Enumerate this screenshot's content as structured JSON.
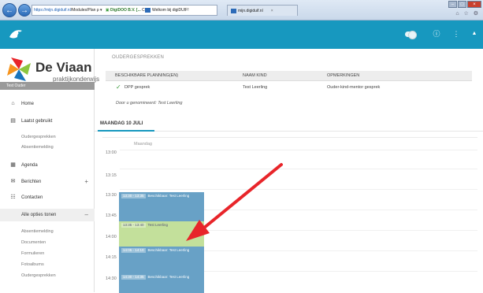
{
  "browser": {
    "url_host": "https://mijn.digiduif.nl",
    "url_path": "/Modules/Plan",
    "url_search": "ρ ▾",
    "cert_name": "DigiDOO B.V. [...",
    "cert_suffix": "C",
    "tabs": [
      {
        "label": "Welkom bij digiDUIF!"
      },
      {
        "label": "mijn.digiduif.nl"
      }
    ],
    "tab_close": "×",
    "back_glyph": "←",
    "forward_glyph": "→",
    "window_controls": {
      "min": "–",
      "max": "□",
      "close": "×"
    },
    "favicons": "⌂ ☆ ⚙"
  },
  "header": {
    "help_icon": "ⓘ",
    "menu_icon": "⋮",
    "user_icon": "▲"
  },
  "sidebar": {
    "brand_name": "De Viaan",
    "brand_sub": "praktijkonderwijs",
    "user_name": "Test Ouder",
    "items": [
      {
        "label": "Home",
        "icon": "⌂",
        "icon_name": "home-icon"
      },
      {
        "label": "Laatst gebruikt",
        "icon": "▤",
        "icon_name": "recent-icon"
      },
      {
        "label": "Oudergesprekken"
      },
      {
        "label": "Absentiemelding"
      },
      {
        "label": "Agenda",
        "icon": "▦",
        "icon_name": "calendar-icon"
      },
      {
        "label": "Berichten",
        "icon": "✉",
        "icon_name": "mail-icon",
        "trailing": "+"
      },
      {
        "label": "Contacten",
        "icon": "☷",
        "icon_name": "contacts-icon"
      },
      {
        "label": "Alle opties tonen",
        "trailing": "–"
      },
      {
        "label": "Absentiemelding"
      },
      {
        "label": "Documenten"
      },
      {
        "label": "Formulieren"
      },
      {
        "label": "Fotoalbums"
      },
      {
        "label": "Oudergesprekken"
      }
    ]
  },
  "main": {
    "section_title": "OUDERGESPREKKEN",
    "table": {
      "headers": [
        "BESCHIKBARE PLANNING(EN)",
        "NAAM KIND",
        "OPMERKINGEN"
      ],
      "row": {
        "check": "✓",
        "planning": "DPP gesprek",
        "kind": "Test Leerling",
        "remark": "Ouder-kind-mentor gesprek"
      }
    },
    "note": "Door u genomineerd: Test Leerling",
    "day_tab": "MAANDAG 10 JULI",
    "calendar": {
      "day_label": "Maandag",
      "times": [
        "13:00",
        "13:15",
        "13:30",
        "13:45",
        "14:00",
        "14:15",
        "14:30"
      ],
      "events": [
        {
          "time": "13:30 - 13:35",
          "label": "Beschikbaar: Test Leerling",
          "style": "blue"
        },
        {
          "time": "13:35 - 13:40",
          "label": "Test Leerling",
          "style": "green"
        },
        {
          "time": "14:05 - 14:10",
          "label": "Beschikbaar: Test Leerling",
          "style": "blue"
        },
        {
          "time": "14:30 - 14:35",
          "label": "Beschikbaar: Test Leerling",
          "style": "blue"
        }
      ]
    }
  },
  "colors": {
    "header": "#1798bf",
    "event_blue": "#68a1c6",
    "event_green": "#c3e09b",
    "arrow": "#e8252a"
  }
}
